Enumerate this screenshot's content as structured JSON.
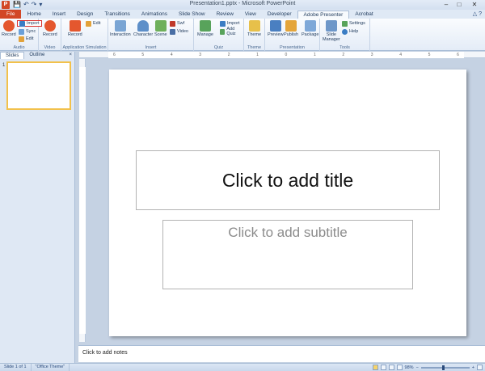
{
  "window": {
    "title": "Presentation1.pptx - Microsoft PowerPoint",
    "app_letter": "P",
    "qat": [
      "💾",
      "↶",
      "↷",
      "▾"
    ],
    "controls": [
      "–",
      "□",
      "✕"
    ]
  },
  "tabs": [
    {
      "label": "File",
      "kind": "file"
    },
    {
      "label": "Home"
    },
    {
      "label": "Insert"
    },
    {
      "label": "Design"
    },
    {
      "label": "Transitions"
    },
    {
      "label": "Animations"
    },
    {
      "label": "Slide Show"
    },
    {
      "label": "Review"
    },
    {
      "label": "View"
    },
    {
      "label": "Developer"
    },
    {
      "label": "Adobe Presenter",
      "kind": "active"
    },
    {
      "label": "Acrobat"
    }
  ],
  "tabs_right": "△ ?",
  "ribbon": {
    "audio": {
      "label": "Audio",
      "record": "Record",
      "import": "Import",
      "sync": "Sync",
      "edit": "Edit"
    },
    "video": {
      "label": "Video",
      "record": "Record"
    },
    "appsim": {
      "label": "Application Simulation",
      "record": "Record",
      "edit": "Edit"
    },
    "insert": {
      "label": "Insert",
      "interaction": "Interaction",
      "character": "Character",
      "scene": "Scene",
      "swf": "Swf",
      "video": "Video"
    },
    "quiz": {
      "label": "Quiz",
      "manage": "Manage",
      "import": "Import",
      "add_quiz": "Add Quiz"
    },
    "theme": {
      "label": "Theme",
      "theme": "Theme"
    },
    "presentation": {
      "label": "Presentation",
      "preview": "Preview",
      "publish": "Publish",
      "package": "Package"
    },
    "tools": {
      "label": "Tools",
      "slide_manager_1": "Slide",
      "slide_manager_2": "Manager",
      "settings": "Settings",
      "help": "Help"
    }
  },
  "ruler_marks": [
    "6",
    "5",
    "4",
    "3",
    "2",
    "1",
    "0",
    "1",
    "2",
    "3",
    "4",
    "5",
    "6"
  ],
  "pane": {
    "tab_slides": "Slides",
    "tab_outline": "Outline",
    "close": "×",
    "slide_number": "1"
  },
  "slide": {
    "title_placeholder": "Click to add title",
    "subtitle_placeholder": "Click to add subtitle"
  },
  "notes": {
    "placeholder": "Click to add notes"
  },
  "status": {
    "slide_info": "Slide 1 of 1",
    "theme": "\"Office Theme\"",
    "zoom": "98%"
  },
  "colors": {
    "file_tab": "#d24726",
    "import_highlight": "#d9302c",
    "selected_thumb": "#f2c14b"
  }
}
